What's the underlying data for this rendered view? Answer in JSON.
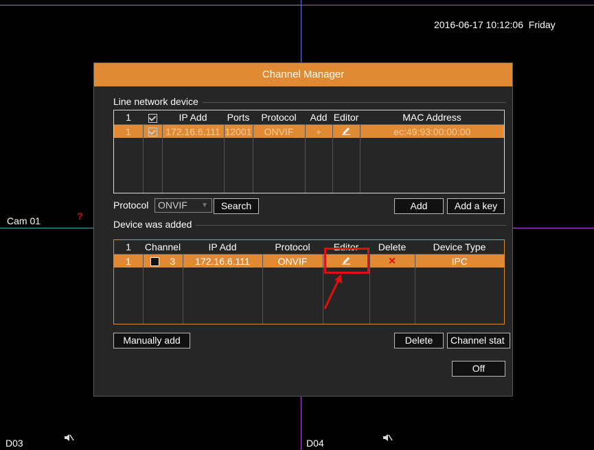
{
  "screen": {
    "datetime": "2016-06-17 10:12:06  Friday",
    "cameras": [
      {
        "label": "Cam 01"
      },
      {
        "label": "D03"
      },
      {
        "label": "D04"
      }
    ],
    "alert_mark": "?"
  },
  "dialog": {
    "title": "Channel Manager",
    "line_network": {
      "section_title": "Line network device",
      "columns": [
        "1",
        "",
        "IP Add",
        "Ports",
        "Protocol",
        "Add",
        "Editor",
        "MAC Address"
      ],
      "rows": [
        {
          "index": "1",
          "checked": true,
          "ip": "172.16.6.111",
          "port": "12001",
          "protocol": "ONVIF",
          "add_icon": "+",
          "mac": "ec:49:93:00:00:00"
        }
      ],
      "protocol_label": "Protocol",
      "protocol_value": "ONVIF",
      "search_button": "Search",
      "add_button": "Add",
      "add_key_button": "Add a key"
    },
    "added": {
      "section_title": "Device was added",
      "columns": [
        "1",
        "Channel",
        "IP Add",
        "Protocol",
        "Editor",
        "Delete",
        "Device Type"
      ],
      "rows": [
        {
          "index": "1",
          "channel": "3",
          "ip": "172.16.6.111",
          "protocol": "ONVIF",
          "delete_icon": "✕",
          "type": "IPC"
        }
      ],
      "manually_add_button": "Manually add",
      "delete_button": "Delete",
      "channel_status_button": "Channel stat",
      "off_button": "Off"
    }
  },
  "colors": {
    "accent": "#e08a33",
    "highlight": "#e01010"
  }
}
